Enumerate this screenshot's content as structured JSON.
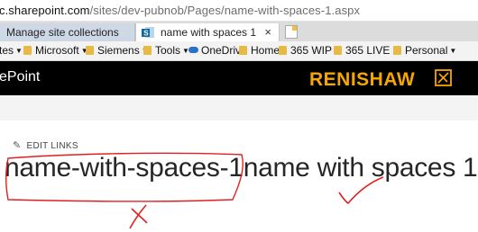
{
  "browser": {
    "address": {
      "host": "c.sharepoint.com",
      "path": "/sites/dev-pubnob/Pages/name-with-spaces-1.aspx"
    },
    "tabs": [
      {
        "label": "Manage site collections"
      },
      {
        "label": "name with spaces 1"
      }
    ],
    "favorites": [
      {
        "label": "tes",
        "icon": "none"
      },
      {
        "label": "Microsoft",
        "icon": "folder-icon"
      },
      {
        "label": "Siemens",
        "icon": "folder-icon"
      },
      {
        "label": "Tools",
        "icon": "folder-icon"
      },
      {
        "label": "OneDrive",
        "icon": "onedrive-icon"
      },
      {
        "label": "Home",
        "icon": "folder-icon"
      },
      {
        "label": "365 WIP",
        "icon": "folder-icon"
      },
      {
        "label": "365 LIVE",
        "icon": "folder-icon"
      },
      {
        "label": "Personal",
        "icon": "folder-icon"
      }
    ]
  },
  "suite_bar": {
    "app_name": "ePoint",
    "brand_logo": "RENISHAW",
    "brand_color": "#f7a600"
  },
  "page": {
    "edit_links_label": "EDIT LINKS",
    "title_url_part": "name-with-spaces-1",
    "title_text_part": "name with spaces 1"
  },
  "annotation": {
    "color": "#e02020",
    "wrong_mark": "cross",
    "right_mark": "tick"
  }
}
